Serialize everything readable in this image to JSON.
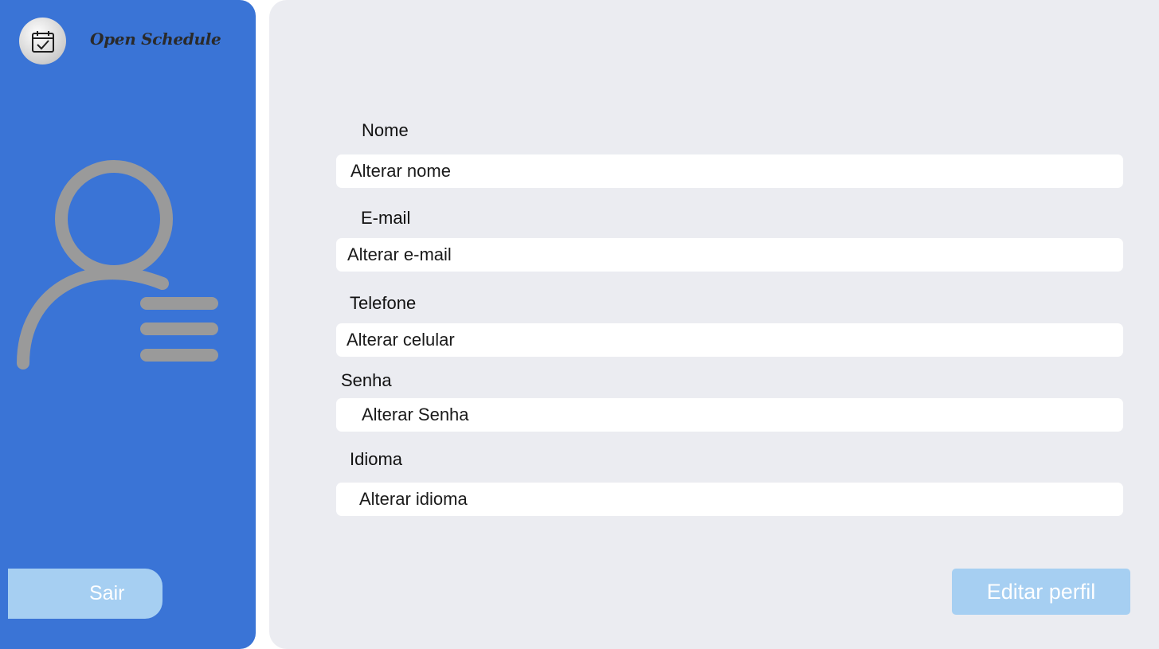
{
  "sidebar": {
    "brand": "Open Schedule",
    "logo_icon": "calendar-check-icon",
    "avatar_icon": "user-list-icon",
    "logout_label": "Sair"
  },
  "form": {
    "nome": {
      "label": "Nome",
      "value": "Alterar nome"
    },
    "email": {
      "label": "E-mail",
      "value": "Alterar e-mail"
    },
    "telefone": {
      "label": "Telefone",
      "value": "Alterar celular"
    },
    "senha": {
      "label": "Senha",
      "value": "Alterar Senha"
    },
    "idioma": {
      "label": "Idioma",
      "value": "Alterar idioma"
    },
    "submit_label": "Editar perfil"
  },
  "colors": {
    "sidebar_bg": "#3a74d6",
    "main_bg": "#ebecf1",
    "button_bg": "#a6cff2",
    "avatar_gray": "#9a9a9a"
  }
}
